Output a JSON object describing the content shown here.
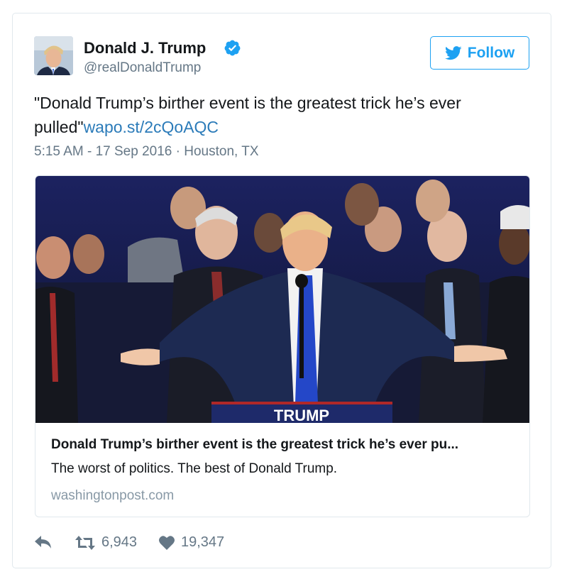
{
  "author": {
    "name": "Donald J. Trump",
    "handle": "@realDonaldTrump",
    "verified": true,
    "avatar_icon": "profile-photo"
  },
  "follow_button": {
    "label": "Follow",
    "icon": "twitter-bird-icon",
    "color": "#1da1f2"
  },
  "tweet": {
    "text": "\"Donald Trump’s birther event is the greatest trick he’s ever pulled\"",
    "link_text": "wapo.st/2cQoAQC",
    "timestamp": "5:15 AM - 17 Sep 2016",
    "separator": "·",
    "location": "Houston, TX"
  },
  "card": {
    "title": "Donald Trump’s birther event is the greatest trick he’s ever pu...",
    "description": "The worst of politics. The best of Donald Trump.",
    "domain": "washingtonpost.com",
    "image_icon": "news-photo",
    "podium_text": "TRUMP"
  },
  "actions": {
    "reply_icon": "reply-icon",
    "retweet_icon": "retweet-icon",
    "retweet_count": "6,943",
    "like_icon": "heart-icon",
    "like_count": "19,347"
  },
  "colors": {
    "link": "#2b7bb9",
    "secondary_text": "#657786",
    "border": "#e1e8ed",
    "verified_badge": "#1da1f2"
  }
}
